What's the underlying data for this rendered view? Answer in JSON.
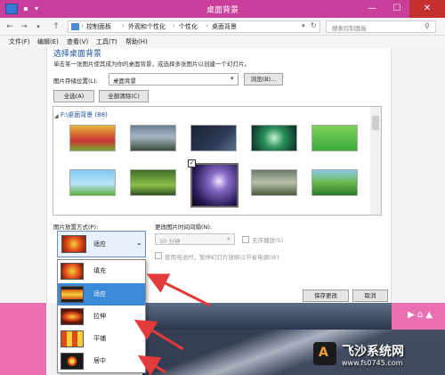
{
  "window": {
    "title": "桌面背景",
    "minimize": "—",
    "maximize": "☐",
    "close": "✕"
  },
  "address": {
    "crumbs": [
      "控制面板",
      "外观和个性化",
      "个性化",
      "桌面背景"
    ],
    "separator": "›",
    "search_placeholder": "搜索控制面板",
    "back": "←",
    "forward": "→",
    "up": "↑"
  },
  "menu": [
    "文件(F)",
    "编辑(E)",
    "查看(V)",
    "工具(T)",
    "帮助(H)"
  ],
  "main": {
    "heading": "选择桌面背景",
    "subtitle": "单击某一张图片使其成为你的桌面背景，或选择多张图片以创建一个幻灯片。",
    "location_label": "图片存储位置(L):",
    "location_value": "桌面背景",
    "browse": "浏览(B)...",
    "select_all": "全选(A)",
    "clear_all": "全部清除(C)",
    "folder_header": "F:\\桌面背景 (88)",
    "position_label": "图片放置方式(P):",
    "position_value": "适应",
    "interval_label": "更改图片时间间隔(N):",
    "interval_value": "30 分钟",
    "shuffle_label": "无序播放(S)",
    "battery_label": "使用电池时，暂停幻灯片放映以节省电源(W)",
    "save": "保存更改",
    "cancel": "取消"
  },
  "dropdown": {
    "options": [
      "填充",
      "适应",
      "拉伸",
      "平铺",
      "居中"
    ],
    "selected": "适应"
  },
  "watermark": {
    "title": "飞沙系统网",
    "url": "www.fs0745.com"
  },
  "colors": {
    "titlebar": "#c83f9b",
    "accent": "#3a8ad8",
    "arrow": "#e33b3b"
  }
}
